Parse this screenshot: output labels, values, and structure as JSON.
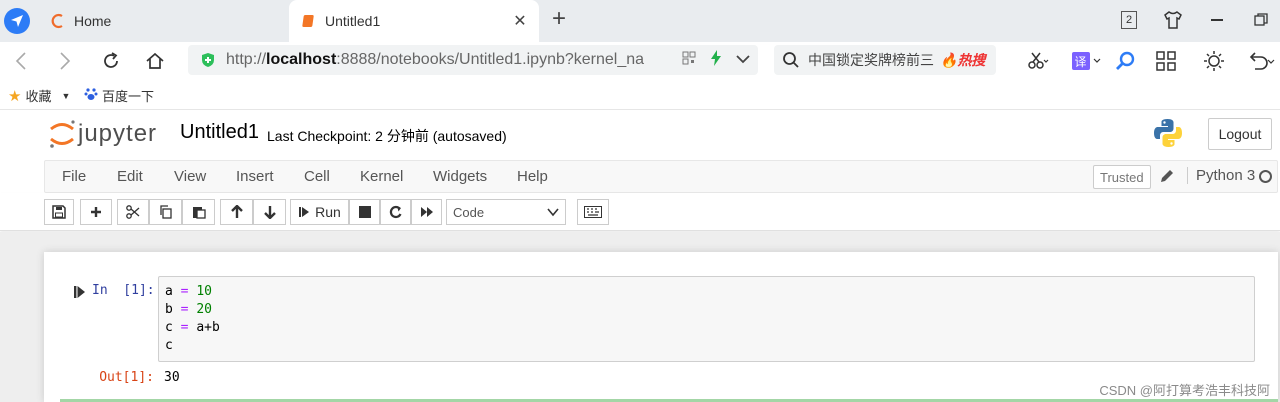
{
  "browser": {
    "tabs": [
      {
        "label": "Home",
        "active": false
      },
      {
        "label": "Untitled1",
        "active": true
      }
    ],
    "window_controls": {
      "tab_count": "2"
    },
    "address": {
      "prefix": "http://",
      "host": "localhost",
      "rest": ":8888/notebooks/Untitled1.ipynb?kernel_na"
    },
    "search": {
      "query": "中国锁定奖牌榜前三",
      "hot_label": "热搜"
    },
    "bookmarks": [
      {
        "label": "收藏",
        "icon": "star-icon"
      },
      {
        "label": "百度一下",
        "icon": "baidu-paw-icon"
      }
    ]
  },
  "jupyter": {
    "logo_text": "jupyter",
    "notebook_title": "Untitled1",
    "checkpoint_text": "Last Checkpoint: 2 分钟前   (autosaved)",
    "logout_label": "Logout",
    "menu": [
      "File",
      "Edit",
      "View",
      "Insert",
      "Cell",
      "Kernel",
      "Widgets",
      "Help"
    ],
    "trusted_label": "Trusted",
    "kernel_name": "Python 3",
    "toolbar": {
      "run_label": "Run",
      "cell_type": "Code"
    },
    "cell": {
      "in_prompt": "In  [1]:",
      "code_lines": [
        {
          "a": "a",
          "op": " = ",
          "b": "10"
        },
        {
          "a": "b",
          "op": " = ",
          "b": "20"
        },
        {
          "a": "c",
          "op": " = ",
          "b": "a+b"
        },
        {
          "a": "c",
          "op": "",
          "b": ""
        }
      ],
      "out_prompt": "Out[1]:",
      "output": "30"
    }
  },
  "watermark": "CSDN @阿打算考浩丰科技阿",
  "colors": {
    "accent_blue": "#2d7cf6",
    "jupyter_orange": "#f37626",
    "in_prompt": "#303f9f",
    "out_prompt": "#d84315"
  }
}
